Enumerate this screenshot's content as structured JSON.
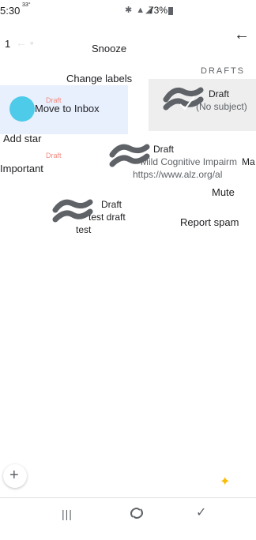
{
  "status_bar": {
    "time": "5:30",
    "temp": "33°",
    "battery": "73%"
  },
  "background": {
    "count": "1"
  },
  "menu": {
    "items": [
      {
        "label": "Snooze"
      },
      {
        "label": "Change labels"
      },
      {
        "label": "Move to Inbox"
      },
      {
        "label": "Add star"
      },
      {
        "label": "Important"
      },
      {
        "label": "Mute"
      },
      {
        "label": "Report spam"
      }
    ]
  },
  "drafts": {
    "header": "DRAFTS",
    "items": [
      {
        "label": "Draft",
        "line1": "(No subject)",
        "line2": ""
      },
      {
        "label": "Draft",
        "line1": "Mild Cognitive Impairm",
        "line1_suffix": "Ma",
        "line2": "https://www.alz.org/al"
      },
      {
        "label": "Draft",
        "line1": "test draft",
        "line2": "test"
      }
    ]
  },
  "small_labels": {
    "draft_red_1": "Draft",
    "draft_red_2": "Draft"
  },
  "colors": {
    "accent": "#4ecbe9",
    "selected_bg": "#e8f0fe",
    "draft_card_bg": "#eeeeee"
  },
  "icons": {
    "back": "arrow-left-icon",
    "compose": "plus-icon",
    "nav_recent": "recent-apps-icon",
    "nav_home": "home-icon",
    "nav_back": "back-nav-icon"
  }
}
